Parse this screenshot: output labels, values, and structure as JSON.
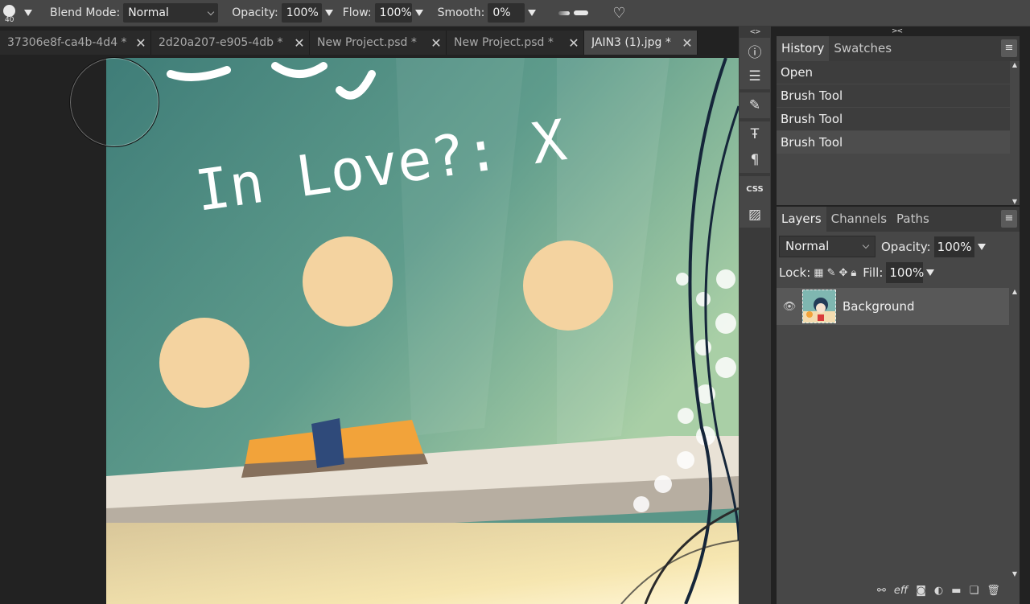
{
  "toolbar": {
    "brush_size": "40",
    "blend_mode_label": "Blend Mode:",
    "blend_mode_value": "Normal",
    "opacity_label": "Opacity:",
    "opacity_value": "100%",
    "flow_label": "Flow:",
    "flow_value": "100%",
    "smooth_label": "Smooth:",
    "smooth_value": "0%"
  },
  "tabs": [
    {
      "label": "37306e8f-ca4b-4d4 *",
      "close": "✕"
    },
    {
      "label": "2d20a207-e905-4db *",
      "close": "✕"
    },
    {
      "label": "New Project.psd *",
      "close": "✕"
    },
    {
      "label": "New Project.psd *",
      "close": "✕"
    },
    {
      "label": "JAIN3 (1).jpg *",
      "close": "✕",
      "active": true
    }
  ],
  "canvas_text": {
    "line1": "In Love?: X"
  },
  "toolstrip": {
    "top_toggle": "<>",
    "css_label": "CSS"
  },
  "right_toggle": "><",
  "history_panel": {
    "tabs": [
      "History",
      "Swatches"
    ],
    "menu": "≡",
    "items": [
      "Open",
      "Brush Tool",
      "Brush Tool",
      "Brush Tool"
    ]
  },
  "layers_panel": {
    "tabs": [
      "Layers",
      "Channels",
      "Paths"
    ],
    "menu": "≡",
    "blend_mode": "Normal",
    "opacity_label": "Opacity:",
    "opacity_value": "100%",
    "lock_label": "Lock:",
    "fill_label": "Fill:",
    "fill_value": "100%",
    "layers": [
      {
        "name": "Background",
        "visible": true
      }
    ],
    "footer": [
      "link",
      "eff",
      "mask",
      "adjust",
      "folder",
      "new",
      "delete"
    ],
    "footer_eff_label": "eff"
  },
  "colors": {
    "chalkboard": "#5a9688",
    "panel": "#474747",
    "dark_bg": "#222222"
  }
}
